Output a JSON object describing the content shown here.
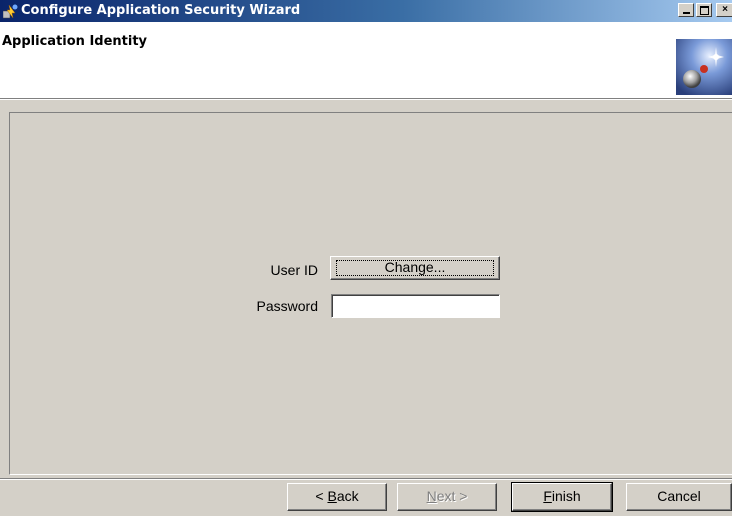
{
  "window": {
    "title": "Configure Application Security Wizard",
    "minimize_label": "_",
    "maximize_label": "□",
    "close_label": "×"
  },
  "header": {
    "title": "Application Identity",
    "graphic_icon": "wizard-planet-graphic"
  },
  "form": {
    "user_id_label": "User ID",
    "change_button": "Change...",
    "password_label": "Password",
    "password_value": ""
  },
  "footer": {
    "back_prefix": "< ",
    "back_hotkey": "B",
    "back_rest": "ack",
    "next_hotkey": "N",
    "next_rest": "ext >",
    "finish_hotkey": "F",
    "finish_rest": "inish",
    "cancel": "Cancel"
  }
}
